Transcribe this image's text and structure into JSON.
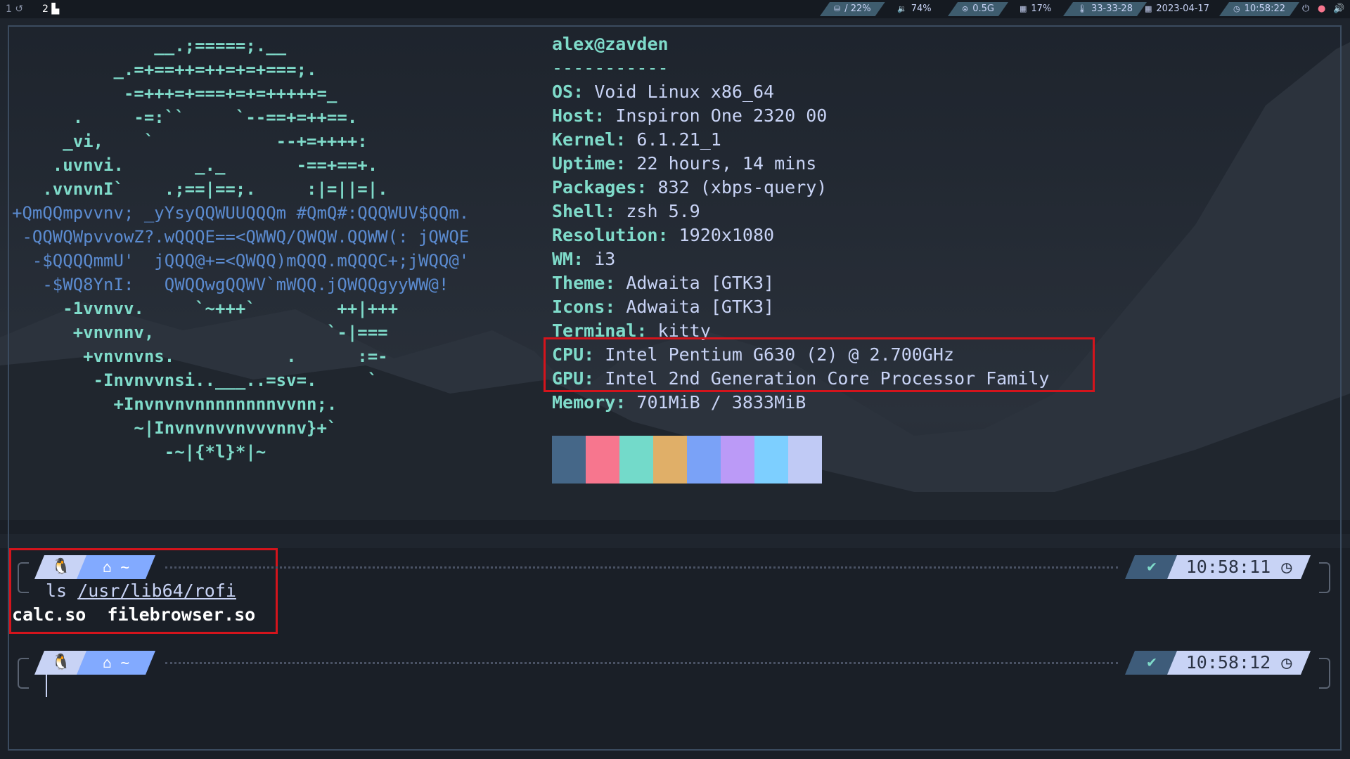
{
  "bar": {
    "workspaces": [
      "1 ↺",
      "2 ▙"
    ],
    "disk": "/ 22%",
    "volume": "74%",
    "memory": "0.5G",
    "cpu": "17%",
    "temps": "33-33-28",
    "date": "2023-04-17",
    "time": "10:58:22",
    "colors": {
      "bar_bg": "#151a21",
      "accent_teal": "#7fdbca",
      "accent_blue": "#82aaff"
    }
  },
  "neofetch": {
    "user_host": "alex@zavden",
    "separator": "-----------",
    "fields": [
      {
        "key": "OS",
        "value": "Void Linux x86_64"
      },
      {
        "key": "Host",
        "value": "Inspiron One 2320 00"
      },
      {
        "key": "Kernel",
        "value": "6.1.21_1"
      },
      {
        "key": "Uptime",
        "value": "22 hours, 14 mins"
      },
      {
        "key": "Packages",
        "value": "832 (xbps-query)"
      },
      {
        "key": "Shell",
        "value": "zsh 5.9"
      },
      {
        "key": "Resolution",
        "value": "1920x1080"
      },
      {
        "key": "WM",
        "value": "i3"
      },
      {
        "key": "Theme",
        "value": "Adwaita [GTK3]"
      },
      {
        "key": "Icons",
        "value": "Adwaita [GTK3]"
      },
      {
        "key": "Terminal",
        "value": "kitty"
      },
      {
        "key": "CPU",
        "value": "Intel Pentium G630 (2) @ 2.700GHz"
      },
      {
        "key": "GPU",
        "value": "Intel 2nd Generation Core Processor Family"
      },
      {
        "key": "Memory",
        "value": "701MiB / 3833MiB"
      }
    ],
    "palette": [
      "#456788",
      "#f7768e",
      "#73daca",
      "#e0af68",
      "#7aa2f7",
      "#bb9af7",
      "#7dcfff",
      "#c0caf5"
    ]
  },
  "ascii_art": [
    "              __.;=====;.__",
    "          _.=+==++=++=+=+===;.",
    "           -=+++=+===+=+=+++++=_",
    "      .     -=:``     `--==+=++==.",
    "     _vi,    `            --+=++++:",
    "    .uvnvi.       _._       -==+==+.",
    "   .vvnvnI`    .;==|==;.     :|=||=|.",
    "+QmQQmpvvnv; _yYsyQQWUUQQQm #QmQ#:QQQWUV$QQm.",
    " -QQWQWpvvowZ?.wQQQE==<QWWQ/QWQW.QQWW(: jQWQE",
    "  -$QQQQmmU'  jQQQ@+=<QWQQ)mQQQ.mQQQC+;jWQQ@'",
    "   -$WQ8YnI:   QWQQwgQQWV`mWQQ.jQWQQgyyWW@!",
    "     -1vvnvv.     `~+++`        ++|+++",
    "      +vnvnnv,                 `-|===",
    "       +vnvnvns.           .      :=-",
    "        -Invnvvnsi..___..=sv=.     `",
    "          +Invnvnvnnnnnnnnvvnn;.",
    "            ~|Invnvnvvnvvvnnv}+`",
    "               -~|{*l}*|~"
  ],
  "terminal": {
    "prompt1": {
      "os_icon": "🐧",
      "dir": "~",
      "status": "✔",
      "time": "10:58:11"
    },
    "command": {
      "cmd": "ls",
      "arg": "/usr/lib64/rofi"
    },
    "output": "calc.so  filebrowser.so",
    "prompt2": {
      "os_icon": "🐧",
      "dir": "~",
      "status": "✔",
      "time": "10:58:12"
    }
  }
}
